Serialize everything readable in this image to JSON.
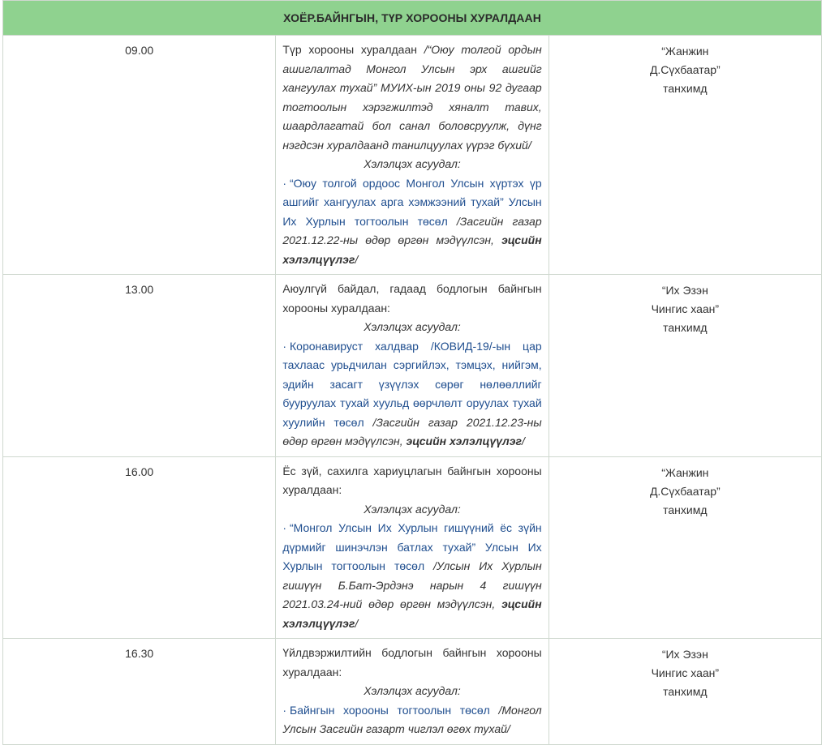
{
  "header": {
    "title": "ХОЁР.БАЙНГЫН, ТҮР ХОРООНЫ ХУРАЛДААН"
  },
  "rows": [
    {
      "time": "09.00",
      "intro": "Түр хорооны хуралдаан ",
      "intro_italic": "/“Оюу толгой ордын ашиглалтад Монгол Улсын эрх ашгийг хангуулах тухай” МУИХ-ын 2019 оны 92 дугаар тогтоолын хэрэгжилтэд хяналт тавих, шаардлагатай бол санал боловсруулж, дүнг нэгдсэн хуралдаанд танилцуулах үүрэг бүхий/",
      "subhead": "Хэлэлцэх асуудал:",
      "item_main": "“Оюу толгой ордоос Монгол Улсын хүртэх үр ашгийг хангуулах арга хэмжээний тухай” Улсын Их Хурлын тогтоолын төсөл",
      "item_note": " /Засгийн газар 2021.12.22-ны өдөр өргөн мэдүүлсэн, ",
      "item_status": "эцсийн хэлэлцүүлэг",
      "item_end": "/",
      "place": [
        "“Жанжин",
        "Д.Сүхбаатар”",
        "танхимд"
      ]
    },
    {
      "time": "13.00",
      "intro": "Аюулгүй байдал, гадаад бодлогын байнгын хорооны хуралдаан:",
      "intro_italic": "",
      "subhead": "Хэлэлцэх асуудал:",
      "item_main": "Коронавируст халдвар /КОВИД-19/-ын цар тахлаас урьдчилан сэргийлэх, тэмцэх, нийгэм, эдийн засагт үзүүлэх сөрөг нөлөөллийг бууруулах тухай хуульд өөрчлөлт оруулах тухай хуулийн төсөл",
      "item_note": " /Засгийн газар 2021.12.23-ны өдөр өргөн мэдүүлсэн, ",
      "item_status": "эцсийн хэлэлцүүлэг",
      "item_end": "/",
      "place": [
        "“Их Эзэн",
        "Чингис хаан”",
        "танхимд"
      ]
    },
    {
      "time": "16.00",
      "intro": "Ёс зүй, сахилга хариуцлагын байнгын хорооны хуралдаан:",
      "intro_italic": "",
      "subhead": "Хэлэлцэх асуудал:",
      "item_main": "“Монгол Улсын Их Хурлын гишүүний ёс зүйн дүрмийг шинэчлэн батлах тухай” Улсын Их Хурлын тогтоолын төсөл",
      "item_note": " /Улсын Их Хурлын гишүүн Б.Бат-Эрдэнэ нарын 4 гишүүн 2021.03.24-ний өдөр өргөн мэдүүлсэн, ",
      "item_status": "эцсийн хэлэлцүүлэг",
      "item_end": "/",
      "place": [
        "“Жанжин",
        "Д.Сүхбаатар”",
        "танхимд"
      ]
    },
    {
      "time": "16.30",
      "intro": "Үйлдвэржилтийн бодлогын байнгын хорооны хуралдаан:",
      "intro_italic": "",
      "subhead": "Хэлэлцэх асуудал:",
      "item_main": "Байнгын хорооны тогтоолын төсөл",
      "item_note": " /Монгол Улсын Засгийн газарт чиглэл өгөх тухай/",
      "item_status": "",
      "item_end": "",
      "place": [
        "“Их Эзэн",
        "Чингис хаан”",
        "танхимд"
      ]
    }
  ],
  "bullet_char": "·"
}
